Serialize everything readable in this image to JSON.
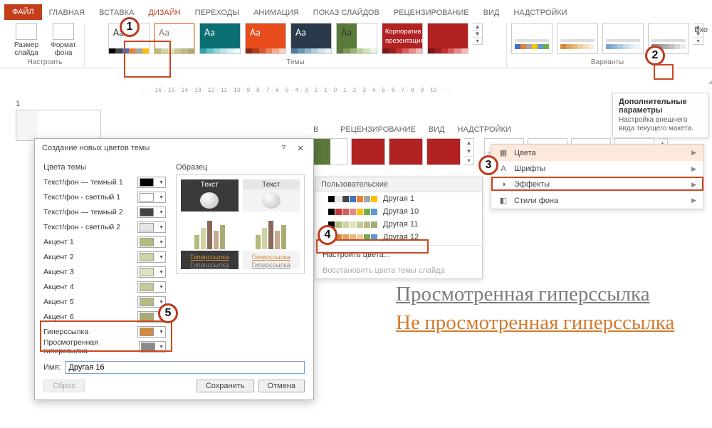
{
  "tabs": {
    "file": "ФАЙЛ",
    "home": "ГЛАВНАЯ",
    "insert": "ВСТАВКА",
    "design": "ДИЗАЙН",
    "transitions": "ПЕРЕХОДЫ",
    "animation": "АНИМАЦИЯ",
    "slideshow": "ПОКАЗ СЛАЙДОВ",
    "review": "РЕЦЕНЗИРОВАНИЕ",
    "view": "ВИД",
    "addins": "НАДСТРОЙКИ"
  },
  "login": "Вхо",
  "ribbon_groups": {
    "customize": "Настроить",
    "themes": "Темы",
    "variants": "Варианты"
  },
  "big_buttons": {
    "slide_size": "Размер\nслайда",
    "bg_format": "Формат\nфона"
  },
  "ruler": "· · · 16 · 15 · 14 · 13 · 12 · 11 · 10 · 9 · 8 · 7 · 6 · 5 · 4 · 3 · 2 · 1 · 0 · 1 · 2 · 3 · 4 · 5 · 6 · 7 · 8 · 9 · 10 · · ·",
  "slide_number": "1",
  "tooltip": {
    "title": "Дополнительные параметры",
    "body": "Настройка внешнего вида текущего макета."
  },
  "mid_tabs": {
    "a": "",
    "review": "РЕЦЕНЗИРОВАНИЕ",
    "view": "ВИД",
    "addins": "НАДСТРОЙКИ"
  },
  "variants_menu": {
    "colors": "Цвета",
    "fonts": "Шрифты",
    "effects": "Эффекты",
    "bg": "Стили фона"
  },
  "colors_panel": {
    "header": "Пользовательские",
    "items": [
      "Другая 1",
      "Другая 10",
      "Другая 11",
      "Другая 12"
    ],
    "customize": "Настроить цвета...",
    "reset": "Восстановить цвета темы слайда"
  },
  "dialog": {
    "title": "Создание новых цветов темы",
    "help": "?",
    "close": "✕",
    "left_caption": "Цвета темы",
    "rows": [
      {
        "label": "Текст/фон — темный 1",
        "color": "#000000"
      },
      {
        "label": "Текст/фон - светлый 1",
        "color": "#ffffff"
      },
      {
        "label": "Текст/фон — темный 2",
        "color": "#444444"
      },
      {
        "label": "Текст/фон - светлый 2",
        "color": "#e7e6e6"
      },
      {
        "label": "Акцент 1",
        "color": "#b5bb7e"
      },
      {
        "label": "Акцент 2",
        "color": "#cfd3a5"
      },
      {
        "label": "Акцент 3",
        "color": "#dfe2bf"
      },
      {
        "label": "Акцент 4",
        "color": "#c6c99a"
      },
      {
        "label": "Акцент 5",
        "color": "#b8bc84"
      },
      {
        "label": "Акцент 6",
        "color": "#a8ac74"
      },
      {
        "label": "Гиперссылка",
        "color": "#d68a3f"
      },
      {
        "label": "Просмотренная гиперссылка",
        "color": "#8a8a8a"
      }
    ],
    "right_caption": "Образец",
    "preview_text": "Текст",
    "link_a": "Гиперссылка",
    "link_b": "Гиперссылка",
    "name_label": "Имя:",
    "name_value": "Другая 16",
    "reset_btn": "Сброс",
    "save_btn": "Сохранить",
    "cancel_btn": "Отмена"
  },
  "sample": {
    "visited": "Просмотренная гиперссылка",
    "unvisited": "Не просмотренная гиперссылка"
  },
  "markers": {
    "1": "1",
    "2": "2",
    "3": "3",
    "4": "4",
    "5": "5"
  }
}
